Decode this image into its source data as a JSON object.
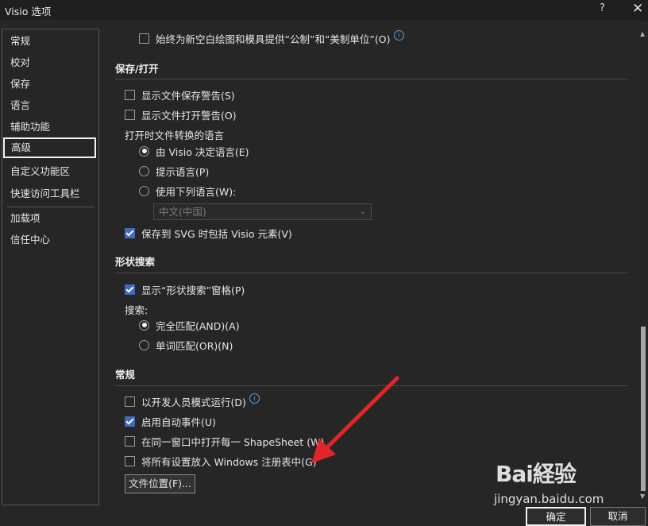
{
  "window": {
    "title": "Visio 选项",
    "help_glyph": "?",
    "close_glyph": "✕"
  },
  "nav": {
    "items": [
      {
        "label": "常规"
      },
      {
        "label": "校对"
      },
      {
        "label": "保存"
      },
      {
        "label": "语言"
      },
      {
        "label": "辅助功能"
      },
      {
        "label": "高级",
        "selected": true
      },
      {
        "label": "自定义功能区"
      },
      {
        "label": "快速访问工具栏"
      },
      {
        "label": "加载项"
      },
      {
        "label": "信任中心"
      }
    ]
  },
  "content": {
    "top_option": {
      "label": "始终为新空白绘图和模具提供“公制”和“美制单位”(O)",
      "checked": false,
      "info_icon": "info-icon"
    },
    "save_open": {
      "heading": "保存/打开",
      "show_save_warning": {
        "label": "显示文件保存警告(S)",
        "checked": false
      },
      "show_open_warning": {
        "label": "显示文件打开警告(O)",
        "checked": false
      },
      "language_label": "打开时文件转换的语言",
      "radio_visio": {
        "label": "由 Visio 决定语言(E)",
        "checked": true
      },
      "radio_prompt": {
        "label": "提示语言(P)",
        "checked": false
      },
      "radio_use": {
        "label": "使用下列语言(W):",
        "checked": false
      },
      "language_select": {
        "value": "中文(中国)",
        "chevron_icon": "chevron-down-icon"
      },
      "include_svg": {
        "label": "保存到 SVG 时包括 Visio 元素(V)",
        "checked": true
      }
    },
    "shape_search": {
      "heading": "形状搜索",
      "show_pane": {
        "label": "显示“形状搜索”窗格(P)",
        "checked": true
      },
      "search_label": "搜索:",
      "match_all": {
        "label": "完全匹配(AND)(A)",
        "checked": true
      },
      "match_any": {
        "label": "单词匹配(OR)(N)",
        "checked": false
      }
    },
    "general": {
      "heading": "常规",
      "developer_mode": {
        "label": "以开发人员模式运行(D)",
        "checked": false,
        "info_icon": "info-icon"
      },
      "auto_events": {
        "label": "启用自动事件(U)",
        "checked": true
      },
      "same_window": {
        "label": "在同一窗口中打开每一 ShapeSheet (W)",
        "checked": false
      },
      "registry": {
        "label": "将所有设置放入 Windows 注册表中(G)",
        "checked": false
      },
      "file_locations_button": "文件位置(F)..."
    }
  },
  "footer": {
    "ok_label": "确定",
    "cancel_label": "取消"
  },
  "watermark": {
    "brand": "Bai経验",
    "url": "jingyan.baidu.com"
  },
  "colors": {
    "background": "#262626",
    "checkbox_checked": "#3e6cbf",
    "info_icon": "#5aa0e8",
    "annotation_arrow": "#e0262b"
  }
}
